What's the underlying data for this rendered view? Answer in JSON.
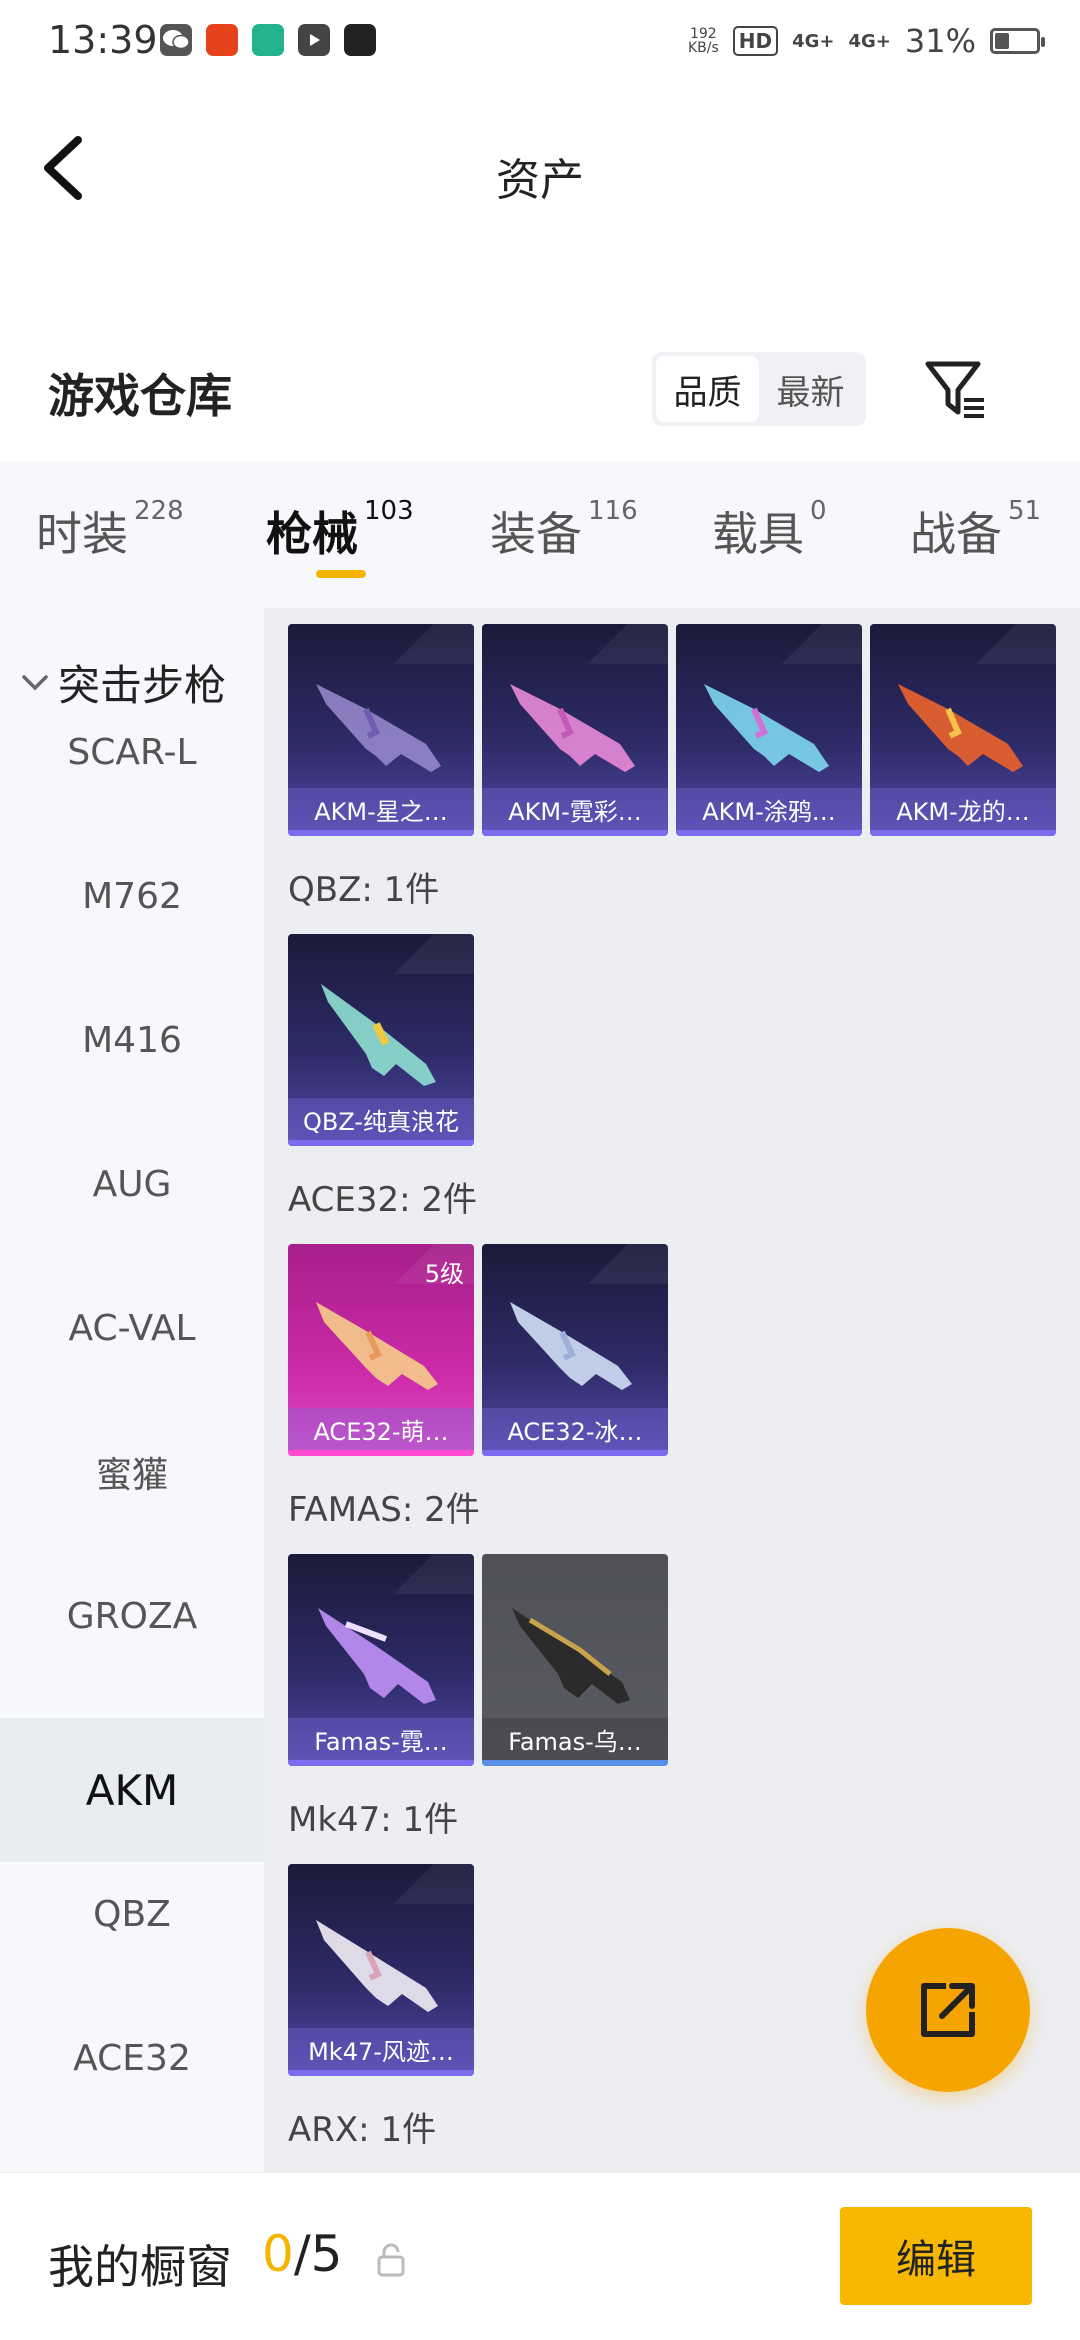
{
  "status_bar": {
    "time": "13:39",
    "app_icons": [
      "wechat-icon",
      "game-icon",
      "boss-zhipin-icon",
      "video-icon",
      "music-icon"
    ],
    "net_speed": "192",
    "net_speed_unit": "KB/s",
    "hd": "HD",
    "signal1": "4G+",
    "signal2": "4G+",
    "battery": "31%"
  },
  "header": {
    "title": "资产"
  },
  "warehouse": {
    "title": "游戏仓库",
    "sort_options": [
      "品质",
      "最新"
    ],
    "sort_active": 0
  },
  "tabs": [
    {
      "label": "时装",
      "count": "228"
    },
    {
      "label": "枪械",
      "count": "103"
    },
    {
      "label": "装备",
      "count": "116"
    },
    {
      "label": "载具",
      "count": "0"
    },
    {
      "label": "战备",
      "count": "51"
    }
  ],
  "active_tab": 1,
  "side_list": {
    "head": "突击步枪",
    "items": [
      "SCAR-L",
      "M762",
      "M416",
      "AUG",
      "AC-VAL",
      "蜜獾",
      "GROZA",
      "AKM",
      "QBZ",
      "ACE32"
    ],
    "active": "AKM"
  },
  "groups": [
    {
      "label": "",
      "items": [
        {
          "name": "AKM-星之…",
          "style": "purple"
        },
        {
          "name": "AKM-霓彩…",
          "style": "purple"
        },
        {
          "name": "AKM-涂鸦…",
          "style": "purple"
        },
        {
          "name": "AKM-龙的…",
          "style": "purple"
        }
      ]
    },
    {
      "label": "QBZ: 1件",
      "items": [
        {
          "name": "QBZ-纯真浪花",
          "style": "purple"
        }
      ]
    },
    {
      "label": "ACE32: 2件",
      "items": [
        {
          "name": "ACE32-萌…",
          "style": "pink",
          "level": "5级"
        },
        {
          "name": "ACE32-冰…",
          "style": "purple"
        }
      ]
    },
    {
      "label": "FAMAS: 2件",
      "items": [
        {
          "name": "Famas-霓…",
          "style": "purple"
        },
        {
          "name": "Famas-乌…",
          "style": "grey"
        }
      ]
    },
    {
      "label": "Mk47: 1件",
      "items": [
        {
          "name": "Mk47-风迹…",
          "style": "purple"
        }
      ]
    },
    {
      "label": "ARX: 1件",
      "items": []
    }
  ],
  "bottom_bar": {
    "showcase_label": "我的橱窗",
    "showcase_current": "0",
    "showcase_total": "/5",
    "edit_label": "编辑"
  },
  "colors": {
    "accent": "#f5b400",
    "fab": "#f6a500",
    "card_purple": "#2d2a66",
    "card_pink": "#cc2aa8"
  }
}
